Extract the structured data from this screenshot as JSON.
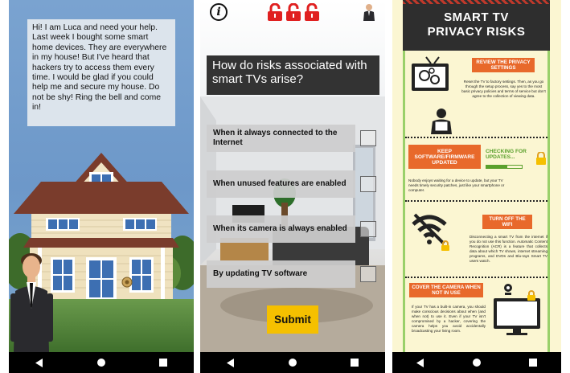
{
  "screen1": {
    "speech": "Hi! I am Luca and need your help. Last week I bought some smart home devices. They are everywhere in my house! But I've heard that hackers try to access them every time. I would be glad if you could help me and secure my house. Do not be shy! Ring the bell and come in!"
  },
  "screen2": {
    "question": "How do risks associated with smart TVs arise?",
    "answers": [
      "When it always connected to the Internet",
      "When unused features are enabled",
      "When its camera is always enabled",
      "By updating TV software"
    ],
    "submit_label": "Submit",
    "info_icon": "info-icon",
    "lock_icons": [
      "lock-icon",
      "lock-icon",
      "lock-icon"
    ],
    "avatar_icon": "avatar-icon"
  },
  "screen3": {
    "title_line1": "SMART TV",
    "title_line2": "PRIVACY RISKS",
    "sections": [
      {
        "heading": "REVIEW THE PRIVACY SETTINGS",
        "text": "Reset the TV to factory settings. Then, as you go through the setup process, say yes to the most basic privacy policies and terms of service but don't agree to the collection of viewing data."
      },
      {
        "heading": "KEEP SOFTWARE/FIRMWARE UPDATED",
        "badge": "CHECKING FOR UPDATES...",
        "text": "Nobody enjoys waiting for a device to update, but your TV needs timely security patches, just like your smartphone or computer."
      },
      {
        "heading": "TURN OFF THE WIFI",
        "text": "Disconnecting a smart TV from the internet if you do not use this function. Automatic Content Recognition (ACR) is a feature that collects data about which TV shows, internet streaming programs, and DVDs and Blu-rays Smart TV users watch."
      },
      {
        "heading": "COVER THE CAMERA WHEN NOT IN USE",
        "text": "If your TV has a built-in camera, you should make conscious decisions about when (and when not) to use it. Even if your TV isn't compromised by a hacker, covering the camera helps you avoid accidentally broadcasting your living room."
      }
    ]
  }
}
